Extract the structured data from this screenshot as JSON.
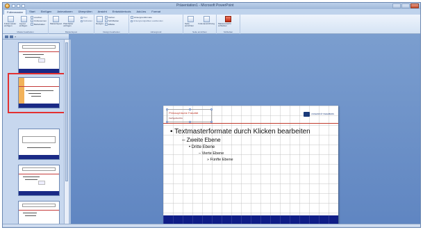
{
  "window": {
    "title": "Präsentation1 - Microsoft PowerPoint"
  },
  "ribbon": {
    "tabs": [
      "Folienmaster",
      "Start",
      "Einfügen",
      "Animationen",
      "Überprüfen",
      "Ansicht",
      "Entwicklertools",
      "Add-Ins",
      "Format"
    ],
    "groups": {
      "master_edit": {
        "label": "Master bearbeiten",
        "insert_master": "Folienmaster einfügen",
        "insert_layout": "Layout einfügen",
        "delete": "Löschen",
        "rename": "Umbenennen",
        "preserve": "Beibehalten"
      },
      "master_layout": {
        "label": "Masterlayout",
        "layout_master": "Masterlayout",
        "insert_placeholder": "Platzhalter einfügen",
        "title": "Titel",
        "footers": "Fußzeilen"
      },
      "design": {
        "label": "Design bearbeiten",
        "designs": "Designs",
        "colors": "Farben",
        "fonts": "Schriftarten",
        "effects": "Effekte"
      },
      "background": {
        "label": "Hintergrund",
        "background_styles": "Hintergrundformate",
        "hide_graphics": "Hintergrundgrafiken ausblenden"
      },
      "page_setup": {
        "label": "Seite einrichten",
        "page_setup": "Seite einrichten",
        "orientation": "Folienausrichtung"
      },
      "close": {
        "label": "Schließen",
        "close_master": "Masteransicht schließen"
      }
    }
  },
  "slide": {
    "title": "Philosophische Fakultät",
    "subtitle": "Fachgebiet/AG",
    "logo_text": "UNIVERSITÄT PADERBORN",
    "bullets": {
      "l1": "• Textmasterformate durch Klicken bearbeiten",
      "l2": "– Zweite Ebene",
      "l3": "• Dritte Ebene",
      "l4": "– Vierte Ebene",
      "l5": "» Fünfte Ebene"
    }
  },
  "colors": {
    "title_red": "#c0392b",
    "footer_band": "#0f1d87",
    "selection": "#e33030",
    "workspace": "#6b8fc7"
  }
}
